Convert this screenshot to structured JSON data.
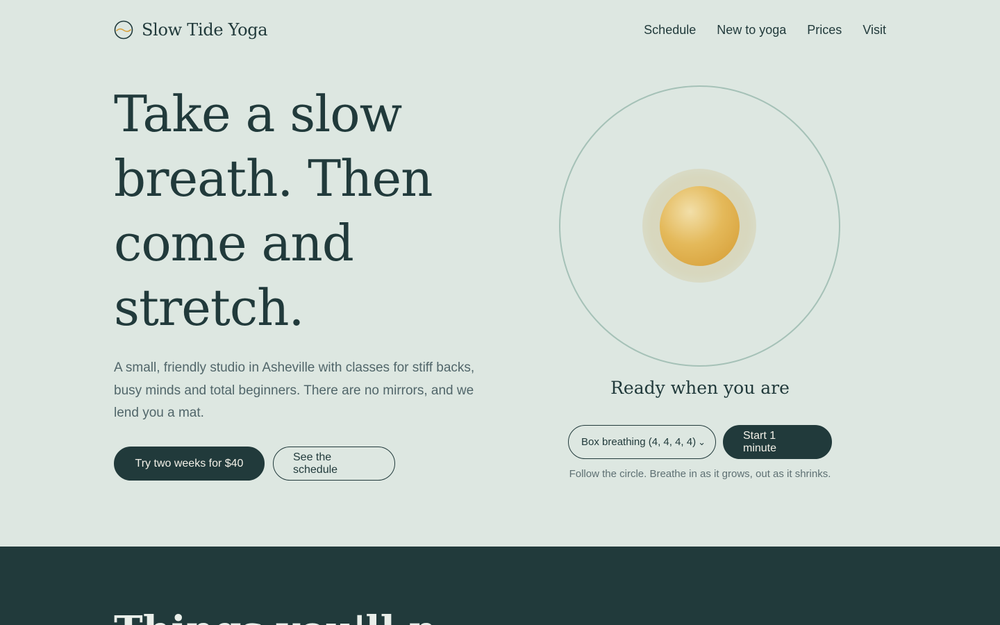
{
  "brand": {
    "name": "Slow Tide Yoga",
    "logo_icon": "tide-circle-icon"
  },
  "nav": [
    "Schedule",
    "New to yoga",
    "Prices",
    "Visit"
  ],
  "hero": {
    "title_lines": [
      "Take a slow",
      "breath. Then",
      "come and",
      "stretch."
    ],
    "text": "A small, friendly studio in Asheville with classes for stiff backs, busy minds and total beginners. There are no mirrors, and we lend you a mat.",
    "primary_cta": "Try two weeks for $40",
    "secondary_cta": "See the schedule"
  },
  "breathing": {
    "status": "Ready when you are",
    "pattern_selected": "Box breathing (4, 4, 4, 4)",
    "start_label": "Start 1 minute",
    "hint": "Follow the circle. Breathe in as it grows, out as it shrinks."
  },
  "next_section": {
    "title_partial": "Things you'll n"
  },
  "colors": {
    "background": "#dde7e1",
    "ink": "#213a3b",
    "ring": "#a5c1b7",
    "orb": "#e0ad48",
    "muted_text": "#51666a"
  }
}
